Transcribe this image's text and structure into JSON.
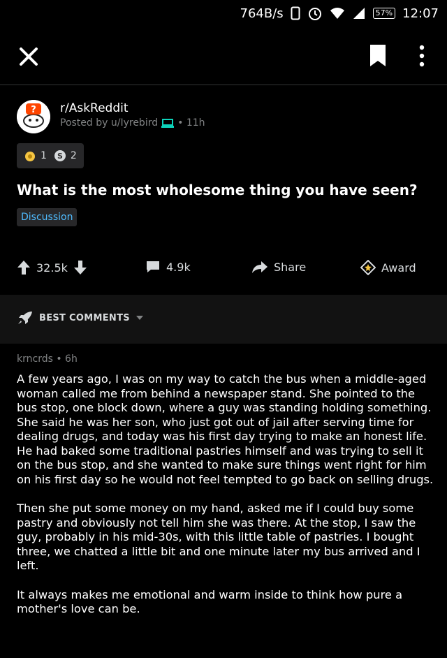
{
  "status_bar": {
    "speed": "764B/s",
    "battery": "57%",
    "time": "12:07"
  },
  "post": {
    "subreddit": "r/AskReddit",
    "posted_by": "Posted by u/Iyrebird",
    "age": "• 11h",
    "awards": [
      {
        "icon": "gold-medal-icon",
        "count": "1"
      },
      {
        "icon": "silver-coin-icon",
        "count": "2"
      }
    ],
    "title": "What is the most wholesome thing you have seen?",
    "flair": "Discussion"
  },
  "actions": {
    "votes": "32.5k",
    "comments": "4.9k",
    "share": "Share",
    "award": "Award"
  },
  "sort": {
    "label": "BEST COMMENTS"
  },
  "comment": {
    "author": "krncrds",
    "age": "• 6h",
    "paragraphs": [
      "A few years ago, I was on my way to catch the bus when a middle-aged  woman called me from behind a newspaper stand. She pointed to the bus stop, one block down, where a guy was standing holding something. She said he was her son, who just got out of jail after serving time for dealing drugs, and today was his first day trying to make an honest life. He had baked some traditional pastries himself and was trying to sell it on the bus stop, and she wanted to make sure things went right for him on his first day so he would not feel tempted to go back on selling drugs.",
      "Then she put some money on my hand, asked me if I could buy some pastry and obviously not tell him she was there. At the stop, I saw the guy, probably in his mid-30s, with this little table of pastries. I bought three, we chatted a little bit and one minute later my bus arrived and I left.",
      "It always makes me emotional and warm inside to think how pure a mother's love can be."
    ]
  },
  "colors": {
    "background": "#000000",
    "flair_text": "#4fbcff",
    "meta_text": "#818384",
    "award_gold": "#f5c542"
  }
}
